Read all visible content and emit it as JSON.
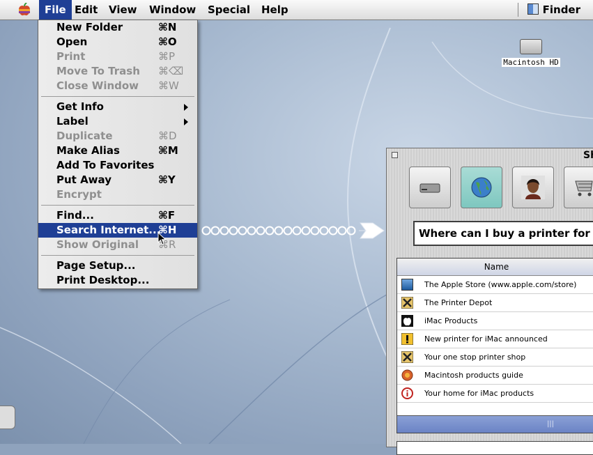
{
  "menubar": {
    "items": [
      "File",
      "Edit",
      "View",
      "Window",
      "Special",
      "Help"
    ],
    "active": "File",
    "app": "Finder"
  },
  "file_menu": {
    "groups": [
      [
        {
          "label": "New Folder",
          "shortcut": "⌘N",
          "enabled": true
        },
        {
          "label": "Open",
          "shortcut": "⌘O",
          "enabled": true
        },
        {
          "label": "Print",
          "shortcut": "⌘P",
          "enabled": false
        },
        {
          "label": "Move To Trash",
          "shortcut": "⌘⌫",
          "enabled": false
        },
        {
          "label": "Close Window",
          "shortcut": "⌘W",
          "enabled": false
        }
      ],
      [
        {
          "label": "Get Info",
          "submenu": true,
          "enabled": true
        },
        {
          "label": "Label",
          "submenu": true,
          "enabled": true
        },
        {
          "label": "Duplicate",
          "shortcut": "⌘D",
          "enabled": false
        },
        {
          "label": "Make Alias",
          "shortcut": "⌘M",
          "enabled": true
        },
        {
          "label": "Add To Favorites",
          "enabled": true
        },
        {
          "label": "Put Away",
          "shortcut": "⌘Y",
          "enabled": true
        },
        {
          "label": "Encrypt",
          "enabled": false
        }
      ],
      [
        {
          "label": "Find...",
          "shortcut": "⌘F",
          "enabled": true
        },
        {
          "label": "Search Internet...",
          "shortcut": "⌘H",
          "enabled": true,
          "highlighted": true
        },
        {
          "label": "Show Original",
          "shortcut": "⌘R",
          "enabled": false
        }
      ],
      [
        {
          "label": "Page Setup...",
          "enabled": true
        },
        {
          "label": "Print Desktop...",
          "enabled": true
        }
      ]
    ]
  },
  "desktop": {
    "hd_label": "Macintosh HD"
  },
  "sherlock": {
    "title_partial": "Sh",
    "tabs": [
      "hard-drive-icon",
      "globe-icon",
      "person-icon",
      "shopping-cart-icon"
    ],
    "selected_tab": "globe-icon",
    "query": "Where can I buy a printer for m",
    "results_header": "Name",
    "results": [
      {
        "name": "The Apple Store (www.apple.com/store)",
        "icon": "apple-store-icon"
      },
      {
        "name": "The Printer Depot",
        "icon": "printer-depot-icon"
      },
      {
        "name": "iMac Products",
        "icon": "apple-logo-icon"
      },
      {
        "name": "New printer for iMac announced",
        "icon": "news-icon"
      },
      {
        "name": "Your one stop printer shop",
        "icon": "printer-shop-icon"
      },
      {
        "name": "Macintosh products guide",
        "icon": "guide-icon"
      },
      {
        "name": "Your home for iMac products",
        "icon": "info-icon"
      }
    ]
  },
  "colors": {
    "menu_highlight": "#1f3f95",
    "sherlock_tab_selected": "#7ec7bf",
    "arrow": "#ffffff"
  }
}
